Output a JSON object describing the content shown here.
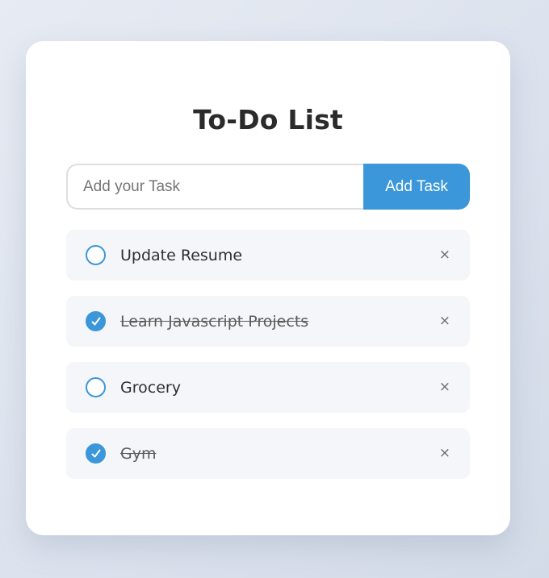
{
  "app": {
    "title": "To-Do List"
  },
  "input": {
    "placeholder": "Add your Task",
    "value": ""
  },
  "add_button": {
    "label": "Add Task"
  },
  "tasks": [
    {
      "text": "Update Resume",
      "completed": false,
      "delete_label": "×"
    },
    {
      "text": "Learn Javascript Projects",
      "completed": true,
      "delete_label": "×"
    },
    {
      "text": "Grocery",
      "completed": false,
      "delete_label": "×"
    },
    {
      "text": "Gym",
      "completed": true,
      "delete_label": "×"
    }
  ],
  "colors": {
    "accent": "#3b97d9",
    "card": "#ffffff",
    "item_bg": "#f4f6f9",
    "title": "#2b2b2b"
  }
}
